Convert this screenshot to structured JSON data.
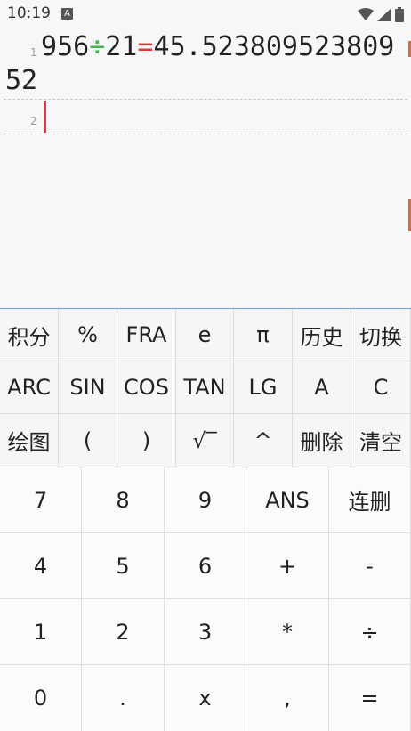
{
  "status_bar": {
    "time": "10:19",
    "notification_badge": "A",
    "icons": [
      "wifi-icon",
      "signal-icon",
      "battery-icon"
    ]
  },
  "editor": {
    "lines": [
      {
        "number": "1",
        "operand1": "956",
        "operator": "÷",
        "operand2": "21",
        "equals": "=",
        "result": "45.52380952380952"
      },
      {
        "number": "2",
        "text": ""
      }
    ],
    "colors": {
      "operator": "#4caf50",
      "equals": "#e53935",
      "cursor": "#e53935",
      "keypad_border": "#6aa5d9"
    }
  },
  "function_keys": [
    [
      "积分",
      "%",
      "FRA",
      "e",
      "π",
      "历史",
      "切换"
    ],
    [
      "ARC",
      "SIN",
      "COS",
      "TAN",
      "LG",
      "A",
      "C"
    ],
    [
      "绘图",
      "(",
      ")",
      "√‾",
      "^",
      "删除",
      "清空"
    ]
  ],
  "number_keys": [
    [
      "7",
      "8",
      "9",
      "ANS",
      "连删"
    ],
    [
      "4",
      "5",
      "6",
      "+",
      "-"
    ],
    [
      "1",
      "2",
      "3",
      "*",
      "÷"
    ],
    [
      "0",
      ".",
      "x",
      ",",
      "="
    ]
  ]
}
